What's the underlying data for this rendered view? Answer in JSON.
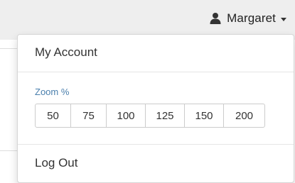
{
  "header": {
    "user_icon": "user-icon",
    "user_name": "Margaret",
    "caret_icon": "caret-down-icon"
  },
  "dropdown": {
    "my_account_label": "My Account",
    "zoom": {
      "label": "Zoom %",
      "options": [
        "50",
        "75",
        "100",
        "125",
        "150",
        "200"
      ]
    },
    "log_out_label": "Log Out"
  },
  "colors": {
    "topbar_bg": "#eeeeee",
    "zoom_label": "#4a7fad",
    "border": "#cccccc"
  }
}
